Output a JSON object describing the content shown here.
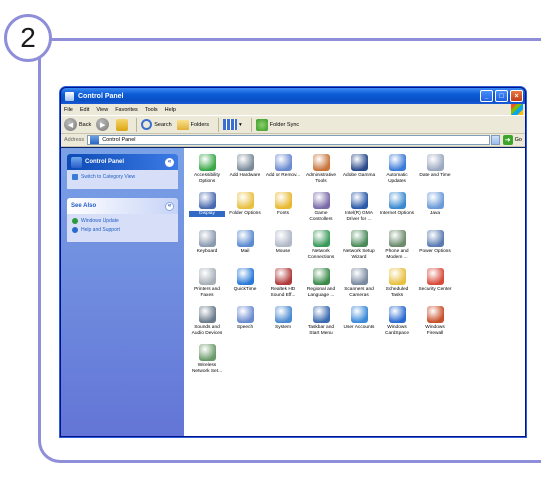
{
  "step": {
    "number": "2"
  },
  "window": {
    "title": "Control Panel",
    "menu": [
      "File",
      "Edit",
      "View",
      "Favorites",
      "Tools",
      "Help"
    ],
    "toolbar": {
      "back": "Back",
      "search": "Search",
      "folders": "Folders",
      "folder_sync": "Folder Sync"
    },
    "address": {
      "label": "Address",
      "value": "Control Panel",
      "go": "Go"
    }
  },
  "taskpane": {
    "control_panel": {
      "title": "Control Panel",
      "link": "Switch to Category View"
    },
    "see_also": {
      "title": "See Also",
      "links": [
        "Windows Update",
        "Help and Support"
      ]
    }
  },
  "items": [
    {
      "label": "Accessibility Options",
      "color": "#3aa84a"
    },
    {
      "label": "Add Hardware",
      "color": "#7a8a9a"
    },
    {
      "label": "Add or Remov...",
      "color": "#6a8ad0"
    },
    {
      "label": "Administrative Tools",
      "color": "#c8743a"
    },
    {
      "label": "Adobe Gamma",
      "color": "#2a4a8a"
    },
    {
      "label": "Automatic Updates",
      "color": "#3a7ad8"
    },
    {
      "label": "Date and Time",
      "color": "#9aa8c0"
    },
    {
      "label": "",
      "color": "#ffffff"
    },
    {
      "label": "Display",
      "color": "#4a6ab0",
      "selected": true
    },
    {
      "label": "Folder Options",
      "color": "#e8c040"
    },
    {
      "label": "Fonts",
      "color": "#e8b830"
    },
    {
      "label": "Game Controllers",
      "color": "#7a6aa8"
    },
    {
      "label": "Intel(R) GMA Driver for ...",
      "color": "#2a5aa8"
    },
    {
      "label": "Internet Options",
      "color": "#3a8ad0"
    },
    {
      "label": "Java",
      "color": "#6a9ad8"
    },
    {
      "label": "",
      "color": "#ffffff"
    },
    {
      "label": "Keyboard",
      "color": "#8a9ab0"
    },
    {
      "label": "Mail",
      "color": "#5a8ad0"
    },
    {
      "label": "Mouse",
      "color": "#b0b8c8"
    },
    {
      "label": "Network Connections",
      "color": "#3a9a5a"
    },
    {
      "label": "Network Setup Wizard",
      "color": "#4a8a5a"
    },
    {
      "label": "Phone and Modem ...",
      "color": "#6a8a6a"
    },
    {
      "label": "Power Options",
      "color": "#5a7ab0"
    },
    {
      "label": "",
      "color": "#ffffff"
    },
    {
      "label": "Printers and Faxes",
      "color": "#a8b0b8"
    },
    {
      "label": "QuickTime",
      "color": "#2a7ad8"
    },
    {
      "label": "Realtek HD Sound Eff...",
      "color": "#b03a3a"
    },
    {
      "label": "Regional and Language ...",
      "color": "#3a8a4a"
    },
    {
      "label": "Scanners and Cameras",
      "color": "#7a8aa0"
    },
    {
      "label": "Scheduled Tasks",
      "color": "#e8c040"
    },
    {
      "label": "Security Center",
      "color": "#d84a3a"
    },
    {
      "label": "",
      "color": "#ffffff"
    },
    {
      "label": "Sounds and Audio Devices",
      "color": "#6a7a8a"
    },
    {
      "label": "Speech",
      "color": "#6a8ad0"
    },
    {
      "label": "System",
      "color": "#4a8ad0"
    },
    {
      "label": "Taskbar and Start Menu",
      "color": "#3a6ab0"
    },
    {
      "label": "User Accounts",
      "color": "#3a8ad8"
    },
    {
      "label": "Windows CardSpace",
      "color": "#2a6ad0"
    },
    {
      "label": "Windows Firewall",
      "color": "#c8502a"
    },
    {
      "label": "",
      "color": "#ffffff"
    },
    {
      "label": "Wireless Network Set...",
      "color": "#6a9a6a"
    }
  ]
}
